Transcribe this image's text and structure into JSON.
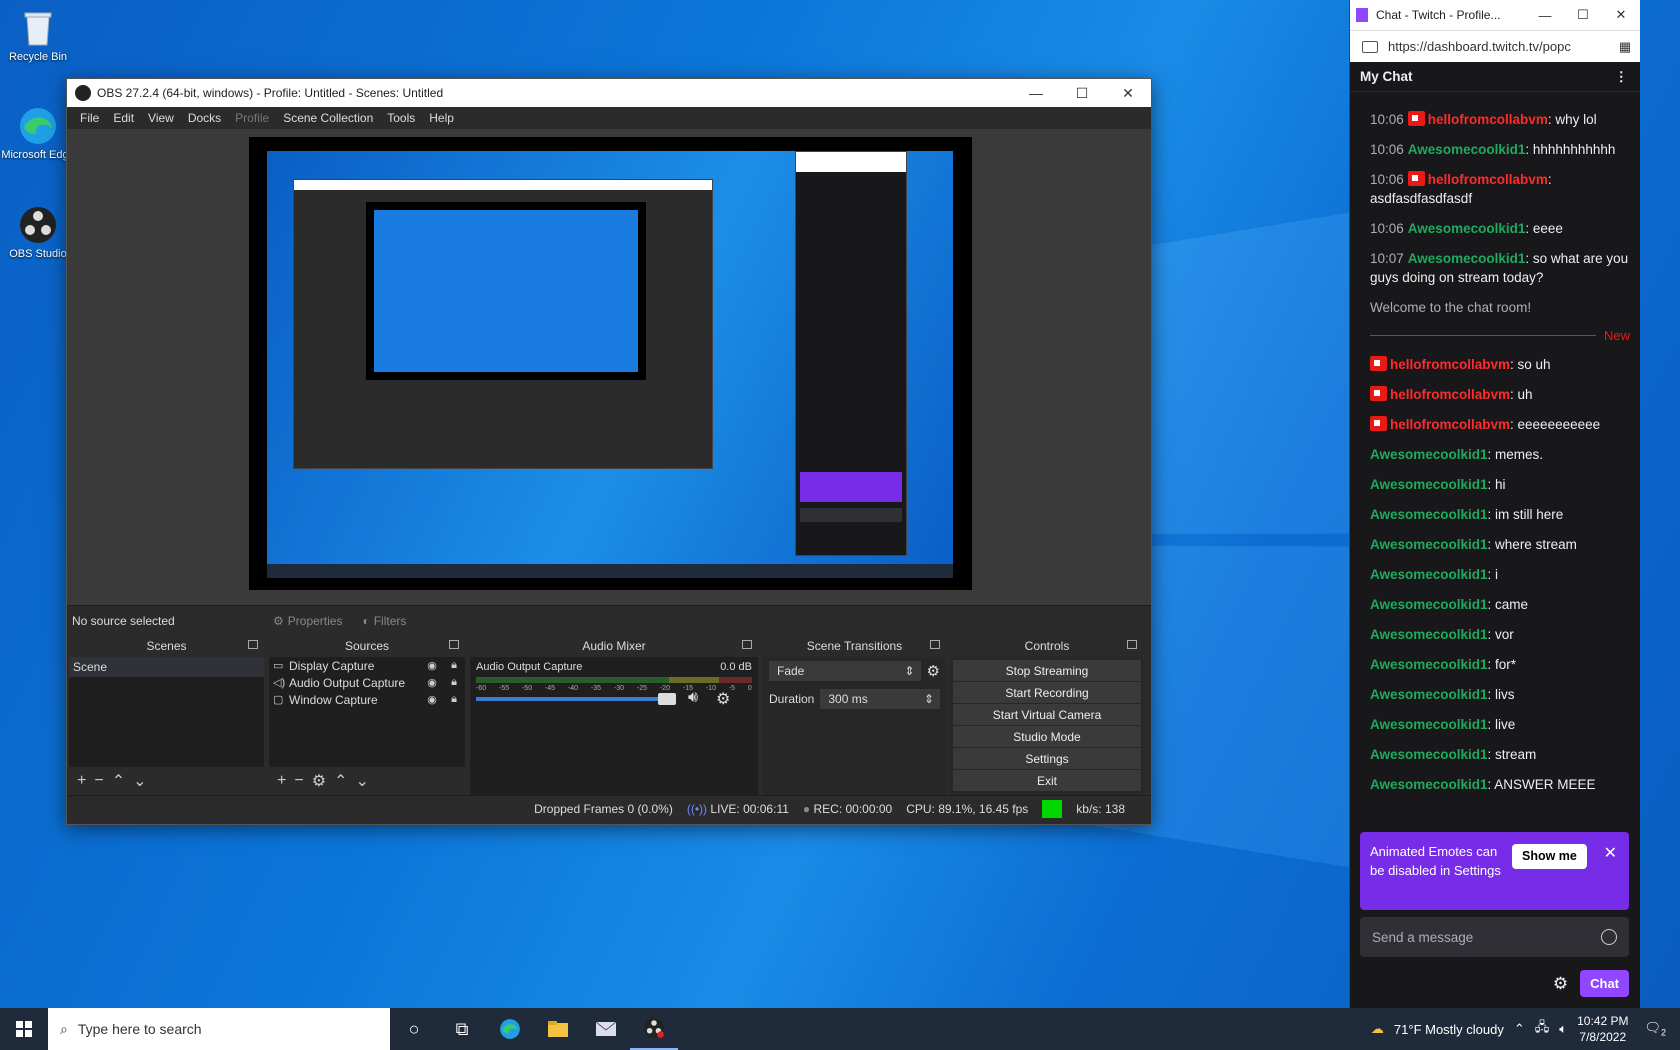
{
  "desktop": {
    "icons": [
      {
        "label": "Recycle Bin"
      },
      {
        "label": "Microsoft Edge"
      },
      {
        "label": "OBS Studio"
      }
    ]
  },
  "obs": {
    "window_title": "OBS 27.2.4 (64-bit, windows) - Profile: Untitled - Scenes: Untitled",
    "menu": [
      "File",
      "Edit",
      "View",
      "Docks",
      "Profile",
      "Scene Collection",
      "Tools",
      "Help"
    ],
    "no_source": "No source selected",
    "properties_label": "Properties",
    "filters_label": "Filters",
    "docks": {
      "scenes": {
        "title": "Scenes",
        "items": [
          "Scene"
        ]
      },
      "sources": {
        "title": "Sources",
        "items": [
          {
            "name": "Display Capture",
            "icon": "monitor-icon"
          },
          {
            "name": "Audio Output Capture",
            "icon": "speaker-icon"
          },
          {
            "name": "Window Capture",
            "icon": "window-icon"
          }
        ]
      },
      "mixer": {
        "title": "Audio Mixer",
        "channel": "Audio Output Capture",
        "level": "0.0 dB",
        "ticks": [
          "-60",
          "-55",
          "-50",
          "-45",
          "-40",
          "-35",
          "-30",
          "-25",
          "-20",
          "-15",
          "-10",
          "-5",
          "0"
        ]
      },
      "transitions": {
        "title": "Scene Transitions",
        "type": "Fade",
        "duration_label": "Duration",
        "duration": "300 ms"
      },
      "controls": {
        "title": "Controls",
        "buttons": [
          "Stop Streaming",
          "Start Recording",
          "Start Virtual Camera",
          "Studio Mode",
          "Settings",
          "Exit"
        ]
      }
    },
    "status": {
      "dropped": "Dropped Frames 0 (0.0%)",
      "live": "LIVE: 00:06:11",
      "rec": "REC: 00:00:00",
      "cpu": "CPU: 89.1%, 16.45 fps",
      "kbs": "kb/s: 138"
    }
  },
  "chat": {
    "window_title": "Chat - Twitch - Profile...",
    "url": "https://dashboard.twitch.tv/popc",
    "header": "My Chat",
    "messages": [
      {
        "time": "10:06",
        "user": "hellofromcollabvm",
        "color": "red",
        "badge": true,
        "text": ": why lol"
      },
      {
        "time": "10:06",
        "user": "Awesomecoolkid1",
        "color": "green",
        "badge": false,
        "text": ": hhhhhhhhhhh"
      },
      {
        "time": "10:06",
        "user": "hellofromcollabvm",
        "color": "red",
        "badge": true,
        "text": ": asdfasdfasdfasdf"
      },
      {
        "time": "10:06",
        "user": "Awesomecoolkid1",
        "color": "green",
        "badge": false,
        "text": ": eeee"
      },
      {
        "time": "10:07",
        "user": "Awesomecoolkid1",
        "color": "green",
        "badge": false,
        "text": ": so what are you guys doing on stream today?"
      }
    ],
    "welcome": "Welcome to the chat room!",
    "new_label": "New",
    "messages_new": [
      {
        "user": "hellofromcollabvm",
        "color": "red",
        "badge": true,
        "text": ": so uh"
      },
      {
        "user": "hellofromcollabvm",
        "color": "red",
        "badge": true,
        "text": ": uh"
      },
      {
        "user": "hellofromcollabvm",
        "color": "red",
        "badge": true,
        "text": ": eeeeeeeeeee"
      },
      {
        "user": "Awesomecoolkid1",
        "color": "green",
        "badge": false,
        "text": ": memes."
      },
      {
        "user": "Awesomecoolkid1",
        "color": "green",
        "badge": false,
        "text": ": hi"
      },
      {
        "user": "Awesomecoolkid1",
        "color": "green",
        "badge": false,
        "text": ": im still here"
      },
      {
        "user": "Awesomecoolkid1",
        "color": "green",
        "badge": false,
        "text": ": where stream"
      },
      {
        "user": "Awesomecoolkid1",
        "color": "green",
        "badge": false,
        "text": ": i"
      },
      {
        "user": "Awesomecoolkid1",
        "color": "green",
        "badge": false,
        "text": ": came"
      },
      {
        "user": "Awesomecoolkid1",
        "color": "green",
        "badge": false,
        "text": ": vor"
      },
      {
        "user": "Awesomecoolkid1",
        "color": "green",
        "badge": false,
        "text": ": for*"
      },
      {
        "user": "Awesomecoolkid1",
        "color": "green",
        "badge": false,
        "text": ": livs"
      },
      {
        "user": "Awesomecoolkid1",
        "color": "green",
        "badge": false,
        "text": ": live"
      },
      {
        "user": "Awesomecoolkid1",
        "color": "green",
        "badge": false,
        "text": ": stream"
      },
      {
        "user": "Awesomecoolkid1",
        "color": "green",
        "badge": false,
        "text": ": ANSWER MEEE"
      }
    ],
    "banner": {
      "text": "Animated Emotes can be disabled in Settings",
      "button": "Show me"
    },
    "input_placeholder": "Send a message",
    "chat_button": "Chat"
  },
  "taskbar": {
    "search_placeholder": "Type here to search",
    "weather": "71°F  Mostly cloudy",
    "time": "10:42 PM",
    "date": "7/8/2022",
    "notification_count": "2"
  },
  "colors": {
    "accent": "#9146ff",
    "live_green": "#00d800",
    "badge_red": "#e91916"
  }
}
